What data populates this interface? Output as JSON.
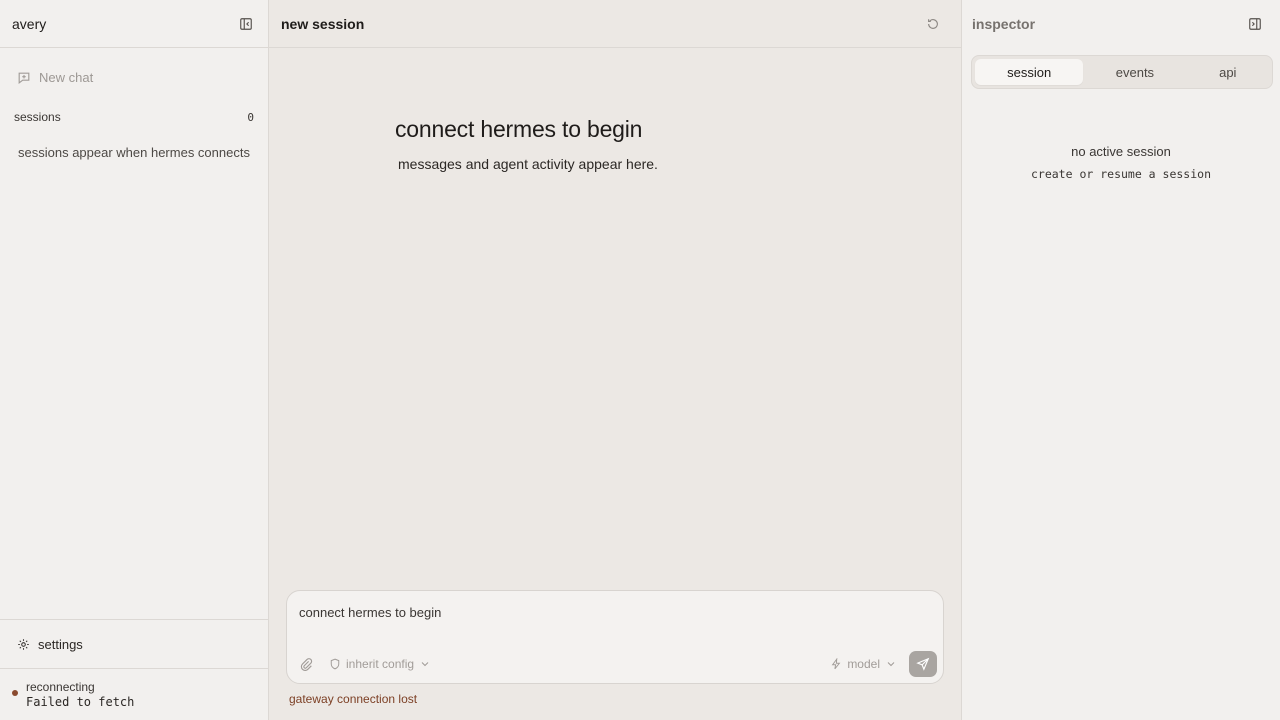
{
  "sidebar": {
    "title": "avery",
    "new_chat_label": "New chat",
    "sessions_label": "sessions",
    "sessions_count": "0",
    "sessions_empty": "sessions appear when hermes connects",
    "settings_label": "settings",
    "status": {
      "state": "reconnecting",
      "message": "Failed to fetch",
      "dot_color": "#8a4a2e"
    }
  },
  "main": {
    "title": "new session",
    "hero_title": "connect hermes to begin",
    "hero_subtitle": "messages and agent activity appear here.",
    "composer": {
      "placeholder": "connect hermes to begin",
      "config_label": "inherit config",
      "model_label": "model"
    },
    "connection_error": "gateway connection lost"
  },
  "inspector": {
    "title": "inspector",
    "tabs": [
      {
        "label": "session",
        "active": true
      },
      {
        "label": "events",
        "active": false
      },
      {
        "label": "api",
        "active": false
      }
    ],
    "empty_title": "no active session",
    "empty_hint": "create or resume a session"
  },
  "icons": {
    "sidebar_toggle": "sidebar-collapse-icon",
    "new_chat": "chat-plus-icon",
    "settings": "gear-icon",
    "refresh": "refresh-icon",
    "attach": "paperclip-icon",
    "config": "shield-icon",
    "model": "lightning-icon",
    "send": "send-icon",
    "inspector_toggle": "panel-right-icon"
  },
  "colors": {
    "error_text": "#7c3f24",
    "send_button": "#a9a5a1"
  }
}
